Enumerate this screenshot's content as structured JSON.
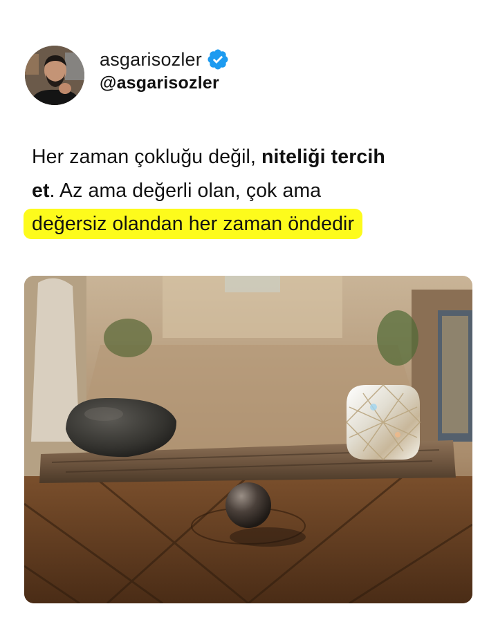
{
  "author": {
    "display_name": "asgarisozler",
    "handle": "@asgarisozler",
    "verified": true,
    "verified_icon": "verified-badge-icon",
    "verified_color": "#1d9bf0"
  },
  "post": {
    "part1": "Her zaman çokluğu değil, ",
    "bold1": "niteliği tercih",
    "bold2": "et",
    "part2": ". Az ama değerli olan, çok ama ",
    "highlight": "değersiz olandan her zaman öndedir",
    "highlight_color": "#fdfb1c"
  },
  "image": {
    "subject": "rock and diamond on a wooden balance plank"
  }
}
